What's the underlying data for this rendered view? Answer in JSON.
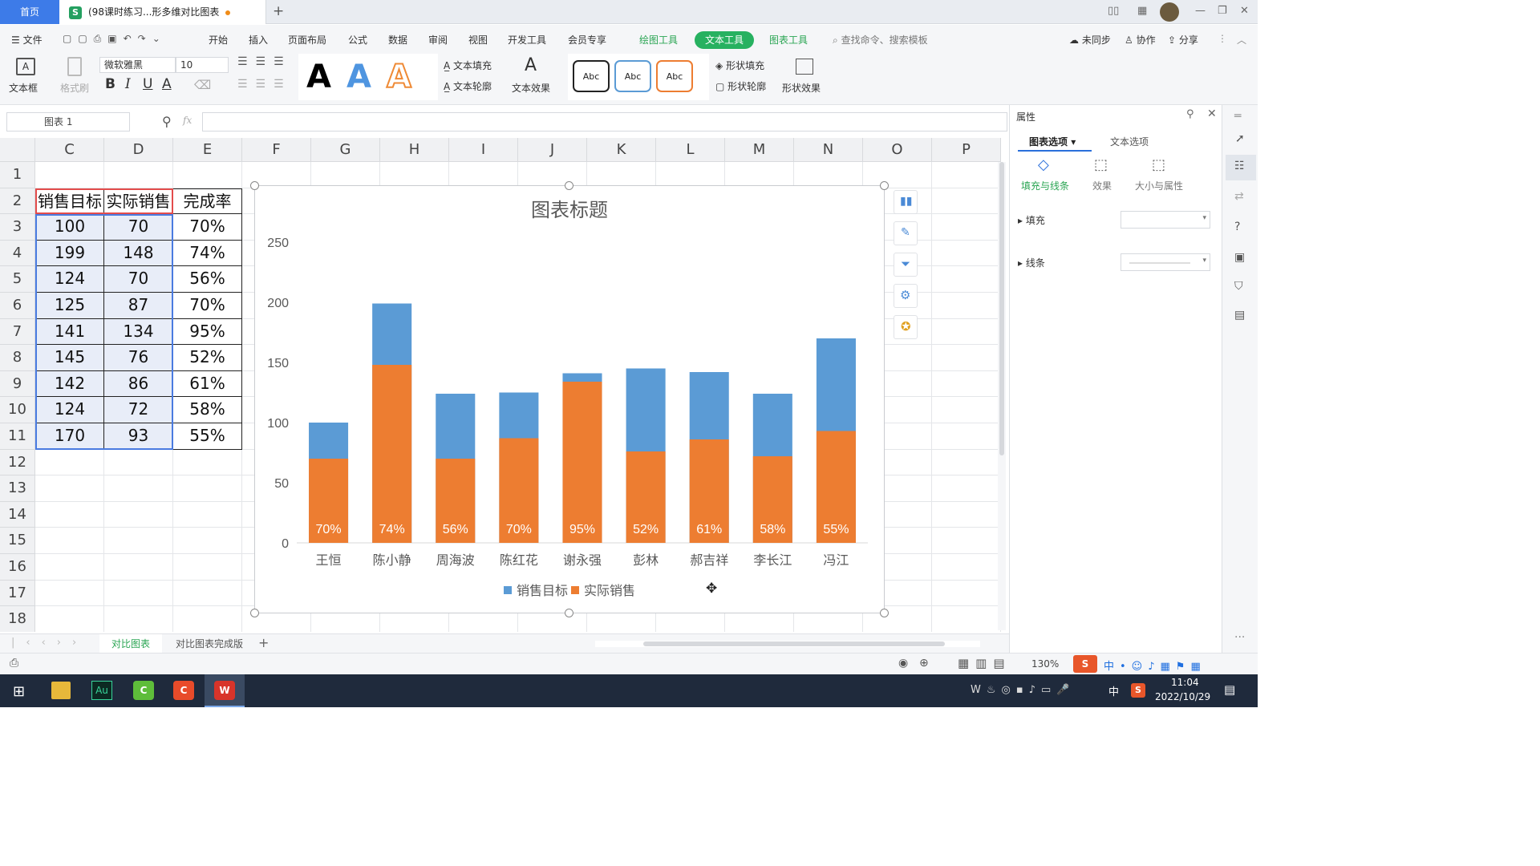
{
  "tabs": {
    "home": "首页",
    "doc": "(98课时练习...形多维对比图表",
    "new_tab": "+"
  },
  "menu": {
    "file": "文件",
    "items": [
      "开始",
      "插入",
      "页面布局",
      "公式",
      "数据",
      "审阅",
      "视图",
      "开发工具",
      "会员专享"
    ],
    "draw_tools": "绘图工具",
    "text_tools": "文本工具",
    "chart_tools": "图表工具",
    "search": "查找命令、搜索模板",
    "unsynced": "未同步",
    "collab": "协作",
    "share": "分享"
  },
  "ribbon": {
    "textbox": "文本框",
    "format_painter": "格式刷",
    "font": "微软雅黑",
    "size": "10",
    "text_fill": "文本填充",
    "text_outline": "文本轮廓",
    "text_effect": "文本效果",
    "style_abc": "Abc",
    "shape_fill": "形状填充",
    "shape_outline": "形状轮廓",
    "shape_effect": "形状效果",
    "bold": "B",
    "italic": "I",
    "underline": "U",
    "font_color": "A",
    "big_a": "A"
  },
  "formula": {
    "name_box": "图表 1",
    "fx": "fx"
  },
  "grid": {
    "columns": [
      "C",
      "D",
      "E",
      "F",
      "G",
      "H",
      "I",
      "J",
      "K",
      "L",
      "M",
      "N",
      "O",
      "P"
    ],
    "rows": [
      "1",
      "2",
      "3",
      "4",
      "5",
      "6",
      "7",
      "8",
      "9",
      "10",
      "11",
      "12",
      "13",
      "14",
      "15",
      "16",
      "17",
      "18"
    ],
    "headers": [
      "销售目标",
      "实际销售",
      "完成率"
    ],
    "data": [
      [
        "100",
        "70",
        "70%"
      ],
      [
        "199",
        "148",
        "74%"
      ],
      [
        "124",
        "70",
        "56%"
      ],
      [
        "125",
        "87",
        "70%"
      ],
      [
        "141",
        "134",
        "95%"
      ],
      [
        "145",
        "76",
        "52%"
      ],
      [
        "142",
        "86",
        "61%"
      ],
      [
        "124",
        "72",
        "58%"
      ],
      [
        "170",
        "93",
        "55%"
      ]
    ]
  },
  "chart_data": {
    "type": "bar",
    "title": "图表标题",
    "categories": [
      "王恒",
      "陈小静",
      "周海波",
      "陈红花",
      "谢永强",
      "彭林",
      "郝吉祥",
      "李长江",
      "冯江"
    ],
    "series": [
      {
        "name": "销售目标",
        "values": [
          100,
          199,
          124,
          125,
          141,
          145,
          142,
          124,
          170
        ],
        "color": "#5b9bd5"
      },
      {
        "name": "实际销售",
        "values": [
          70,
          148,
          70,
          87,
          134,
          76,
          86,
          72,
          93
        ],
        "color": "#ed7d31"
      }
    ],
    "data_labels": [
      "70%",
      "74%",
      "56%",
      "70%",
      "95%",
      "52%",
      "61%",
      "58%",
      "55%"
    ],
    "ylim": [
      0,
      250
    ],
    "yticks": [
      "0",
      "50",
      "100",
      "150",
      "200",
      "250"
    ],
    "overlap": true,
    "grid": false,
    "legend": "bottom"
  },
  "sheets": {
    "active": "对比图表",
    "other": "对比图表完成版"
  },
  "panel": {
    "title": "属性",
    "tab_chart": "图表选项",
    "tab_text": "文本选项",
    "sub_fill": "填充与线条",
    "sub_effect": "效果",
    "sub_size": "大小与属性",
    "fill": "填充",
    "line": "线条"
  },
  "status": {
    "zoom": "130%"
  },
  "taskbar": {
    "time": "11:04",
    "date": "2022/10/29",
    "ime": "中"
  }
}
